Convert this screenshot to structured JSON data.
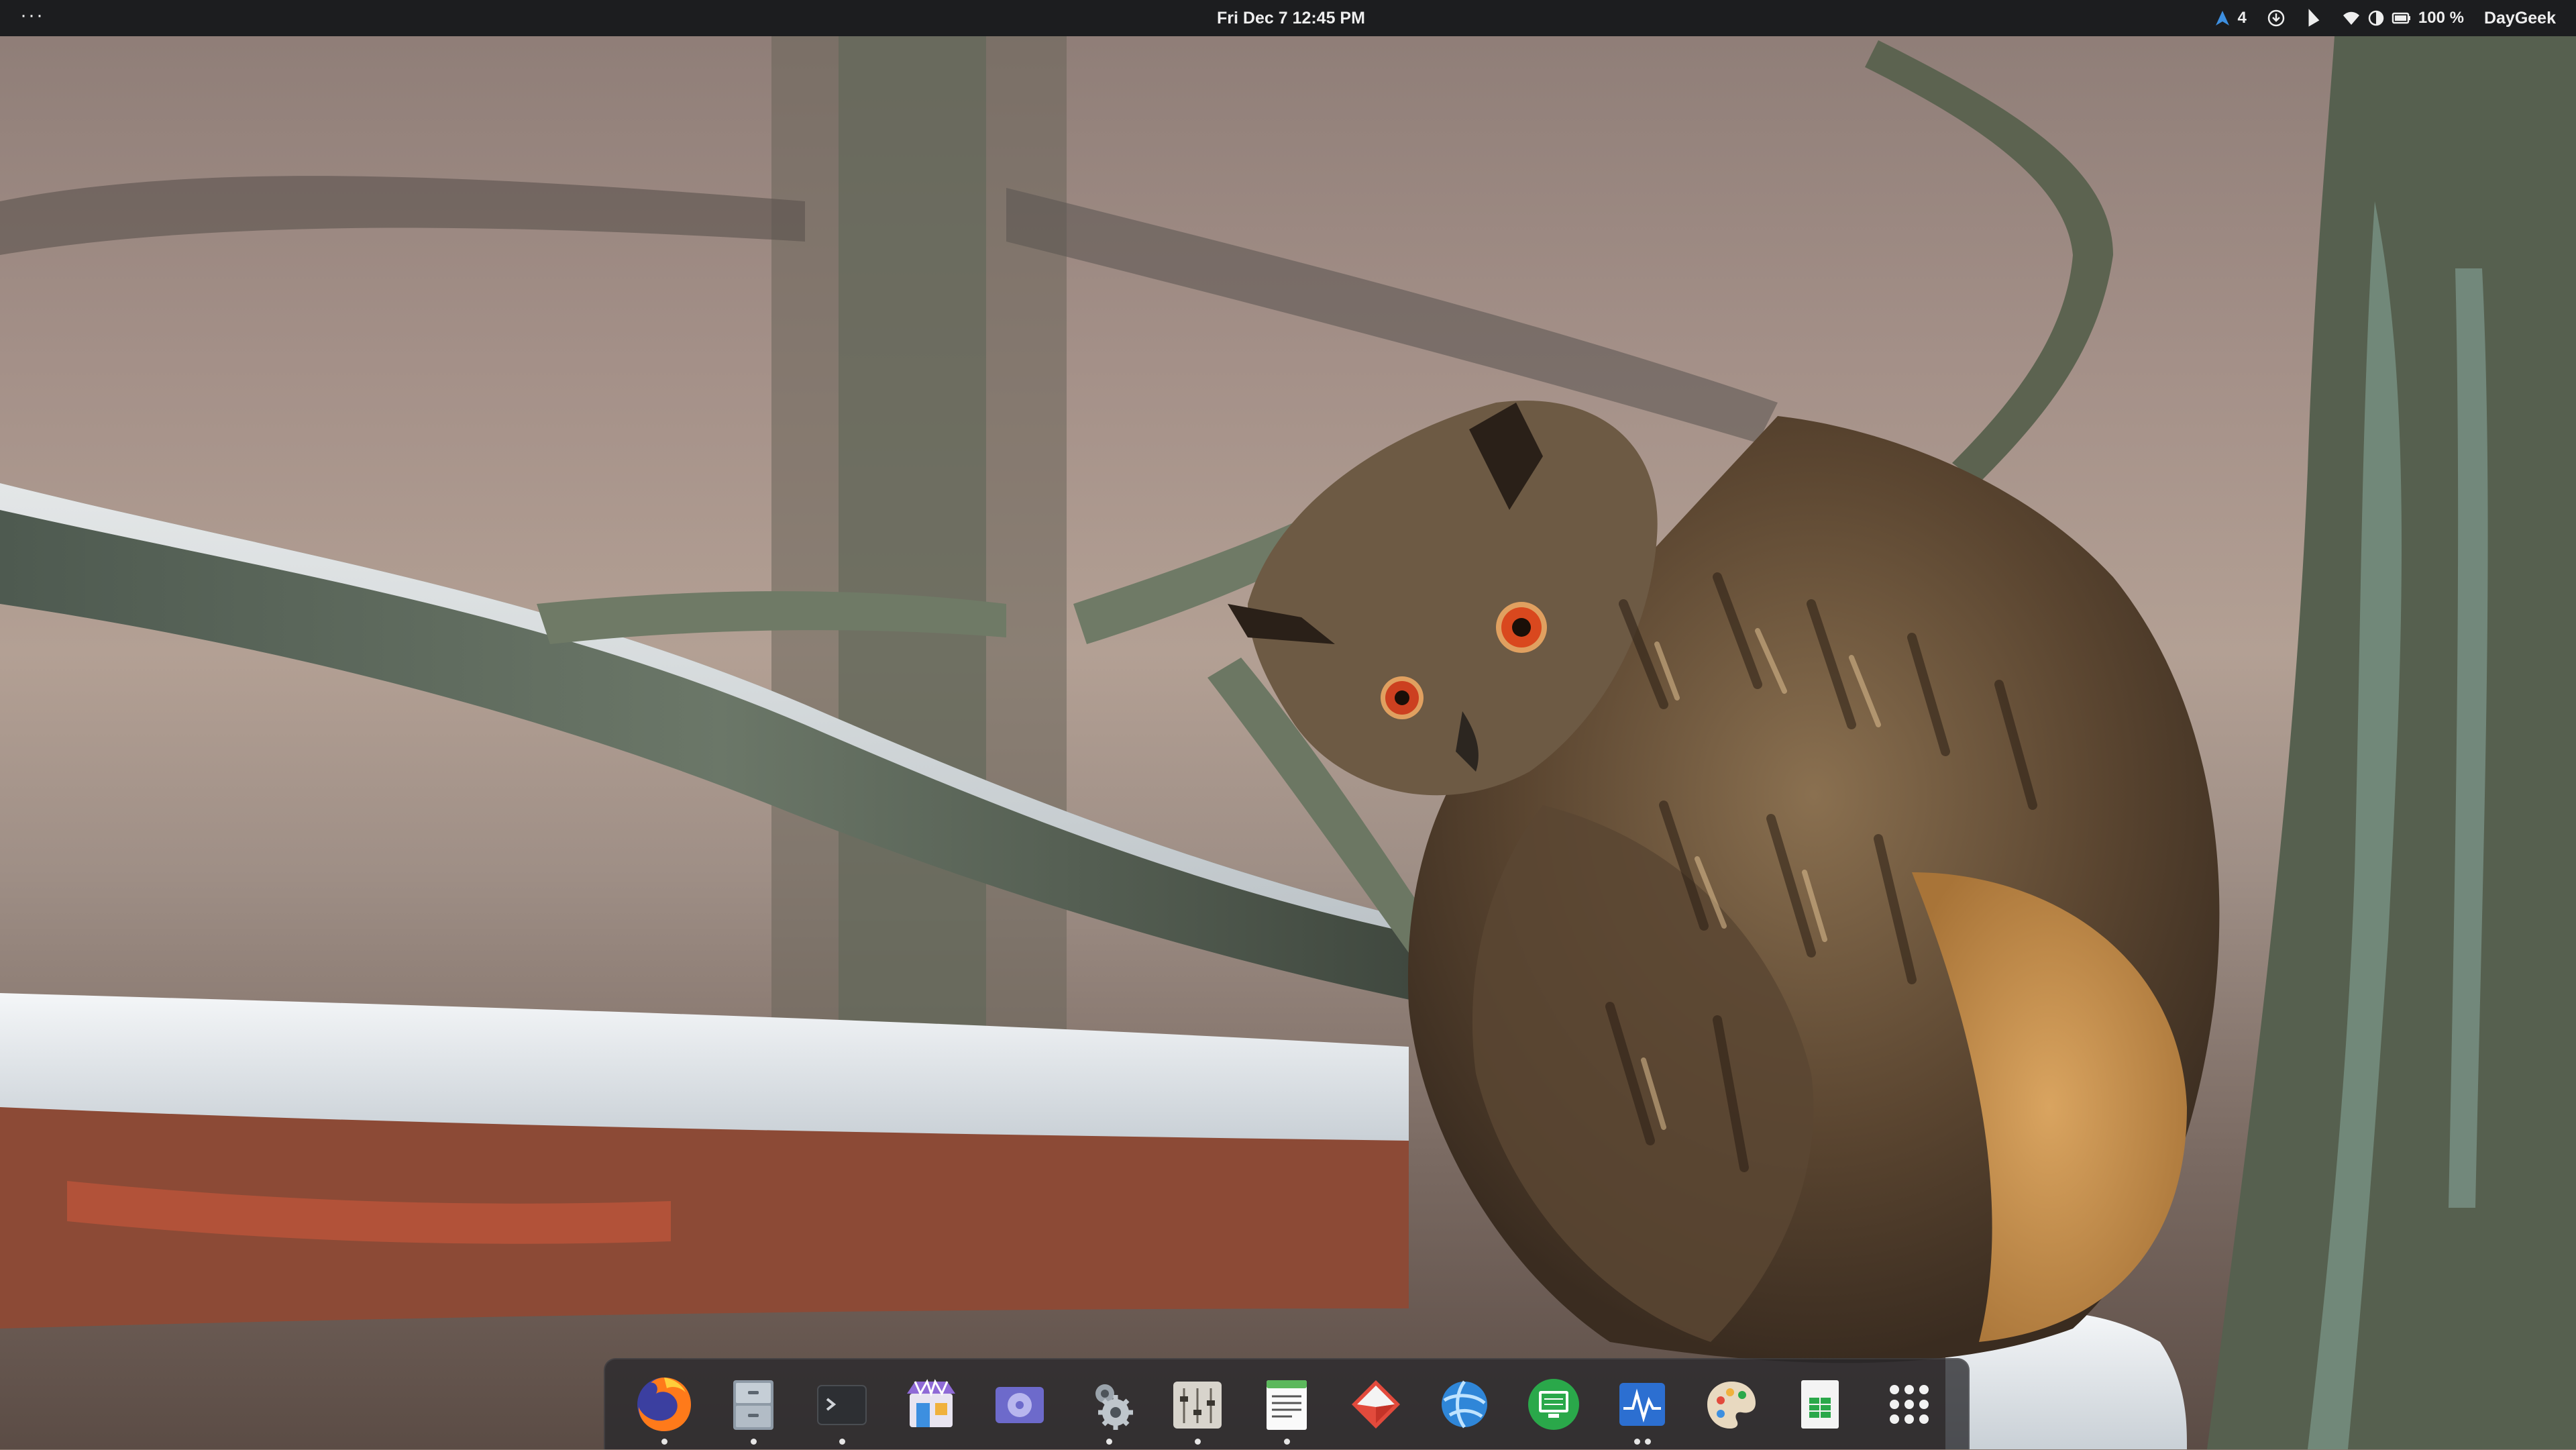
{
  "topbar": {
    "activities_label": "···",
    "clock": "Fri Dec 7  12:45 PM",
    "notif_count": "4",
    "battery": "100 %",
    "user": "DayGeek"
  },
  "icons": {
    "activities": "more-dots-icon",
    "notifications": "arrow-up-icon",
    "updates": "download-circle-icon",
    "bluetooth": "bluetooth-icon",
    "wifi": "wifi-icon",
    "volume": "volume-icon",
    "battery": "battery-icon"
  },
  "dock": {
    "apps": [
      {
        "name": "firefox",
        "icon": "firefox-icon",
        "running": true
      },
      {
        "name": "files",
        "icon": "files-cabinet-icon",
        "running": true
      },
      {
        "name": "terminal",
        "icon": "terminal-icon",
        "running": true
      },
      {
        "name": "app-center",
        "icon": "store-icon",
        "running": false
      },
      {
        "name": "disk-utility",
        "icon": "disk-icon",
        "running": false
      },
      {
        "name": "settings",
        "icon": "gear-icon",
        "running": true
      },
      {
        "name": "mixer",
        "icon": "sliders-icon",
        "running": true
      },
      {
        "name": "text-editor",
        "icon": "notes-icon",
        "running": true
      },
      {
        "name": "calculator",
        "icon": "calculator-diamond-icon",
        "running": false
      },
      {
        "name": "browser",
        "icon": "globe-arrow-icon",
        "running": false
      },
      {
        "name": "remote-desktop",
        "icon": "monitor-icon",
        "running": false
      },
      {
        "name": "system-monitor",
        "icon": "pulse-icon",
        "running": true,
        "windows": 2
      },
      {
        "name": "color-picker",
        "icon": "palette-icon",
        "running": false
      },
      {
        "name": "spreadsheet",
        "icon": "spreadsheet-icon",
        "running": false
      },
      {
        "name": "app-grid",
        "icon": "grid-dots-icon",
        "running": false
      }
    ]
  },
  "colors": {
    "topbar_bg": "#1c1d1f",
    "accent_blue": "#3d8fe0"
  }
}
